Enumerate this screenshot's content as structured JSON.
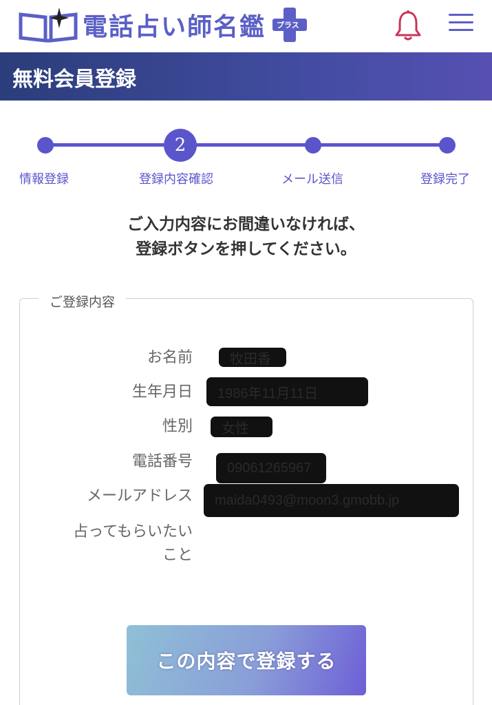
{
  "header": {
    "logo_text": "電話占い師名鑑",
    "logo_badge": "プラス",
    "icons": [
      "book-star-logo-icon",
      "bell-icon",
      "hamburger-menu-icon"
    ]
  },
  "page_title": "無料会員登録",
  "stepper": {
    "current_step": "2",
    "steps": [
      {
        "label": "情報登録"
      },
      {
        "label": "登録内容確認"
      },
      {
        "label": "メール送信"
      },
      {
        "label": "登録完了"
      }
    ]
  },
  "instruction": {
    "line1": "ご入力内容にお間違いなければ、",
    "line2": "登録ボタンを押してください。"
  },
  "registration": {
    "legend": "ご登録内容",
    "fields": [
      {
        "label": "お名前",
        "value": "牧田香"
      },
      {
        "label": "生年月日",
        "value": "1986年11月11日"
      },
      {
        "label": "性別",
        "value": "女性"
      },
      {
        "label": "電話番号",
        "value": "09061265967"
      },
      {
        "label": "メールアドレス",
        "value": "maida0493@moon3.gmobb.jp"
      },
      {
        "label_line1": "占ってもらいたい",
        "label_line2": "こと",
        "value": ""
      }
    ]
  },
  "submit_label": "この内容で登録する",
  "colors": {
    "accent": "#5b55cc",
    "title_bar": "#414ca0",
    "bell": "#c8355a"
  }
}
